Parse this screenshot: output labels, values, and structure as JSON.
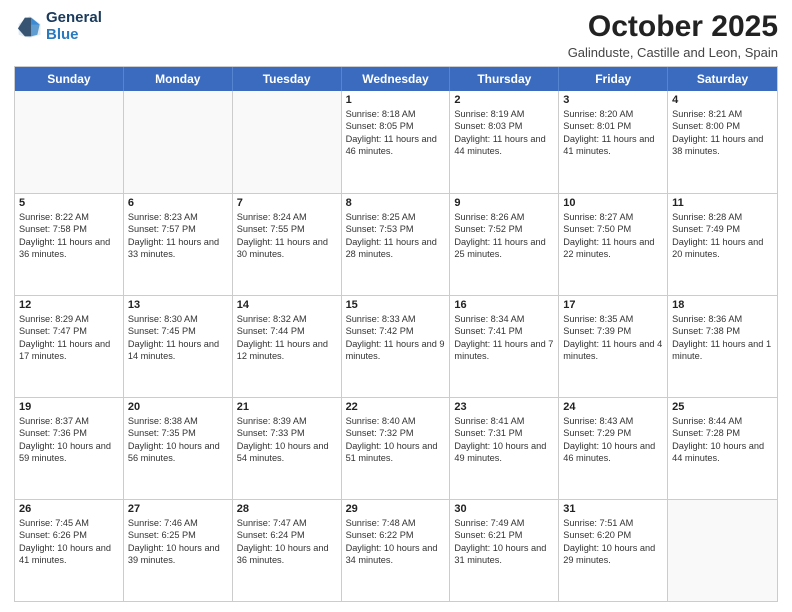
{
  "header": {
    "logo_line1": "General",
    "logo_line2": "Blue",
    "title": "October 2025",
    "subtitle": "Galinduste, Castille and Leon, Spain"
  },
  "calendar": {
    "days_of_week": [
      "Sunday",
      "Monday",
      "Tuesday",
      "Wednesday",
      "Thursday",
      "Friday",
      "Saturday"
    ],
    "weeks": [
      [
        {
          "day": "",
          "empty": true
        },
        {
          "day": "",
          "empty": true
        },
        {
          "day": "",
          "empty": true
        },
        {
          "day": "1",
          "sunrise": "8:18 AM",
          "sunset": "8:05 PM",
          "daylight": "11 hours and 46 minutes."
        },
        {
          "day": "2",
          "sunrise": "8:19 AM",
          "sunset": "8:03 PM",
          "daylight": "11 hours and 44 minutes."
        },
        {
          "day": "3",
          "sunrise": "8:20 AM",
          "sunset": "8:01 PM",
          "daylight": "11 hours and 41 minutes."
        },
        {
          "day": "4",
          "sunrise": "8:21 AM",
          "sunset": "8:00 PM",
          "daylight": "11 hours and 38 minutes."
        }
      ],
      [
        {
          "day": "5",
          "sunrise": "8:22 AM",
          "sunset": "7:58 PM",
          "daylight": "11 hours and 36 minutes."
        },
        {
          "day": "6",
          "sunrise": "8:23 AM",
          "sunset": "7:57 PM",
          "daylight": "11 hours and 33 minutes."
        },
        {
          "day": "7",
          "sunrise": "8:24 AM",
          "sunset": "7:55 PM",
          "daylight": "11 hours and 30 minutes."
        },
        {
          "day": "8",
          "sunrise": "8:25 AM",
          "sunset": "7:53 PM",
          "daylight": "11 hours and 28 minutes."
        },
        {
          "day": "9",
          "sunrise": "8:26 AM",
          "sunset": "7:52 PM",
          "daylight": "11 hours and 25 minutes."
        },
        {
          "day": "10",
          "sunrise": "8:27 AM",
          "sunset": "7:50 PM",
          "daylight": "11 hours and 22 minutes."
        },
        {
          "day": "11",
          "sunrise": "8:28 AM",
          "sunset": "7:49 PM",
          "daylight": "11 hours and 20 minutes."
        }
      ],
      [
        {
          "day": "12",
          "sunrise": "8:29 AM",
          "sunset": "7:47 PM",
          "daylight": "11 hours and 17 minutes."
        },
        {
          "day": "13",
          "sunrise": "8:30 AM",
          "sunset": "7:45 PM",
          "daylight": "11 hours and 14 minutes."
        },
        {
          "day": "14",
          "sunrise": "8:32 AM",
          "sunset": "7:44 PM",
          "daylight": "11 hours and 12 minutes."
        },
        {
          "day": "15",
          "sunrise": "8:33 AM",
          "sunset": "7:42 PM",
          "daylight": "11 hours and 9 minutes."
        },
        {
          "day": "16",
          "sunrise": "8:34 AM",
          "sunset": "7:41 PM",
          "daylight": "11 hours and 7 minutes."
        },
        {
          "day": "17",
          "sunrise": "8:35 AM",
          "sunset": "7:39 PM",
          "daylight": "11 hours and 4 minutes."
        },
        {
          "day": "18",
          "sunrise": "8:36 AM",
          "sunset": "7:38 PM",
          "daylight": "11 hours and 1 minute."
        }
      ],
      [
        {
          "day": "19",
          "sunrise": "8:37 AM",
          "sunset": "7:36 PM",
          "daylight": "10 hours and 59 minutes."
        },
        {
          "day": "20",
          "sunrise": "8:38 AM",
          "sunset": "7:35 PM",
          "daylight": "10 hours and 56 minutes."
        },
        {
          "day": "21",
          "sunrise": "8:39 AM",
          "sunset": "7:33 PM",
          "daylight": "10 hours and 54 minutes."
        },
        {
          "day": "22",
          "sunrise": "8:40 AM",
          "sunset": "7:32 PM",
          "daylight": "10 hours and 51 minutes."
        },
        {
          "day": "23",
          "sunrise": "8:41 AM",
          "sunset": "7:31 PM",
          "daylight": "10 hours and 49 minutes."
        },
        {
          "day": "24",
          "sunrise": "8:43 AM",
          "sunset": "7:29 PM",
          "daylight": "10 hours and 46 minutes."
        },
        {
          "day": "25",
          "sunrise": "8:44 AM",
          "sunset": "7:28 PM",
          "daylight": "10 hours and 44 minutes."
        }
      ],
      [
        {
          "day": "26",
          "sunrise": "7:45 AM",
          "sunset": "6:26 PM",
          "daylight": "10 hours and 41 minutes."
        },
        {
          "day": "27",
          "sunrise": "7:46 AM",
          "sunset": "6:25 PM",
          "daylight": "10 hours and 39 minutes."
        },
        {
          "day": "28",
          "sunrise": "7:47 AM",
          "sunset": "6:24 PM",
          "daylight": "10 hours and 36 minutes."
        },
        {
          "day": "29",
          "sunrise": "7:48 AM",
          "sunset": "6:22 PM",
          "daylight": "10 hours and 34 minutes."
        },
        {
          "day": "30",
          "sunrise": "7:49 AM",
          "sunset": "6:21 PM",
          "daylight": "10 hours and 31 minutes."
        },
        {
          "day": "31",
          "sunrise": "7:51 AM",
          "sunset": "6:20 PM",
          "daylight": "10 hours and 29 minutes."
        },
        {
          "day": "",
          "empty": true
        }
      ]
    ]
  }
}
